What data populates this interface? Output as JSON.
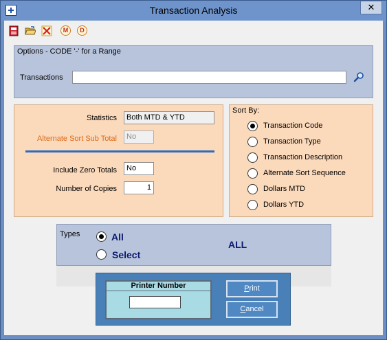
{
  "window": {
    "title": "Transaction Analysis",
    "close_glyph": "✕"
  },
  "toolbar": {
    "items": [
      {
        "name": "save-icon"
      },
      {
        "name": "open-folder-icon"
      },
      {
        "name": "delete-icon"
      },
      {
        "name": "m-icon",
        "label": "M"
      },
      {
        "name": "d-icon",
        "label": "D"
      }
    ]
  },
  "options": {
    "caption": "Options - CODE '-' for a Range",
    "transactions_label": "Transactions",
    "transactions_value": ""
  },
  "stats": {
    "statistics_label": "Statistics",
    "statistics_value": "Both MTD & YTD",
    "alt_sort_label": "Alternate Sort Sub Total",
    "alt_sort_value": "No",
    "zero_totals_label": "Include Zero Totals",
    "zero_totals_value": "No",
    "copies_label": "Number of Copies",
    "copies_value": "1"
  },
  "sort": {
    "caption": "Sort By:",
    "options": [
      {
        "label": "Transaction Code",
        "selected": true
      },
      {
        "label": "Transaction Type",
        "selected": false
      },
      {
        "label": "Transaction Description",
        "selected": false
      },
      {
        "label": "Alternate Sort Sequence",
        "selected": false
      },
      {
        "label": "Dollars MTD",
        "selected": false
      },
      {
        "label": "Dollars YTD",
        "selected": false
      }
    ]
  },
  "types": {
    "caption": "Types",
    "options": [
      {
        "label": "All",
        "selected": true
      },
      {
        "label": "Select",
        "selected": false
      }
    ],
    "value": "ALL"
  },
  "printer": {
    "caption": "Printer Number",
    "value": "",
    "print_label": "Print",
    "print_hotkey": "P",
    "cancel_label": "Cancel",
    "cancel_hotkey": "C"
  },
  "colors": {
    "title_bar": "#6f94cc",
    "panel_blue": "#b8c4dc",
    "panel_peach": "#fbd9bb",
    "accent_orange": "#d86a18",
    "divider_blue": "#2c6cc0",
    "printer_panel": "#4a80b8",
    "label_navy": "#0c1a6e"
  }
}
